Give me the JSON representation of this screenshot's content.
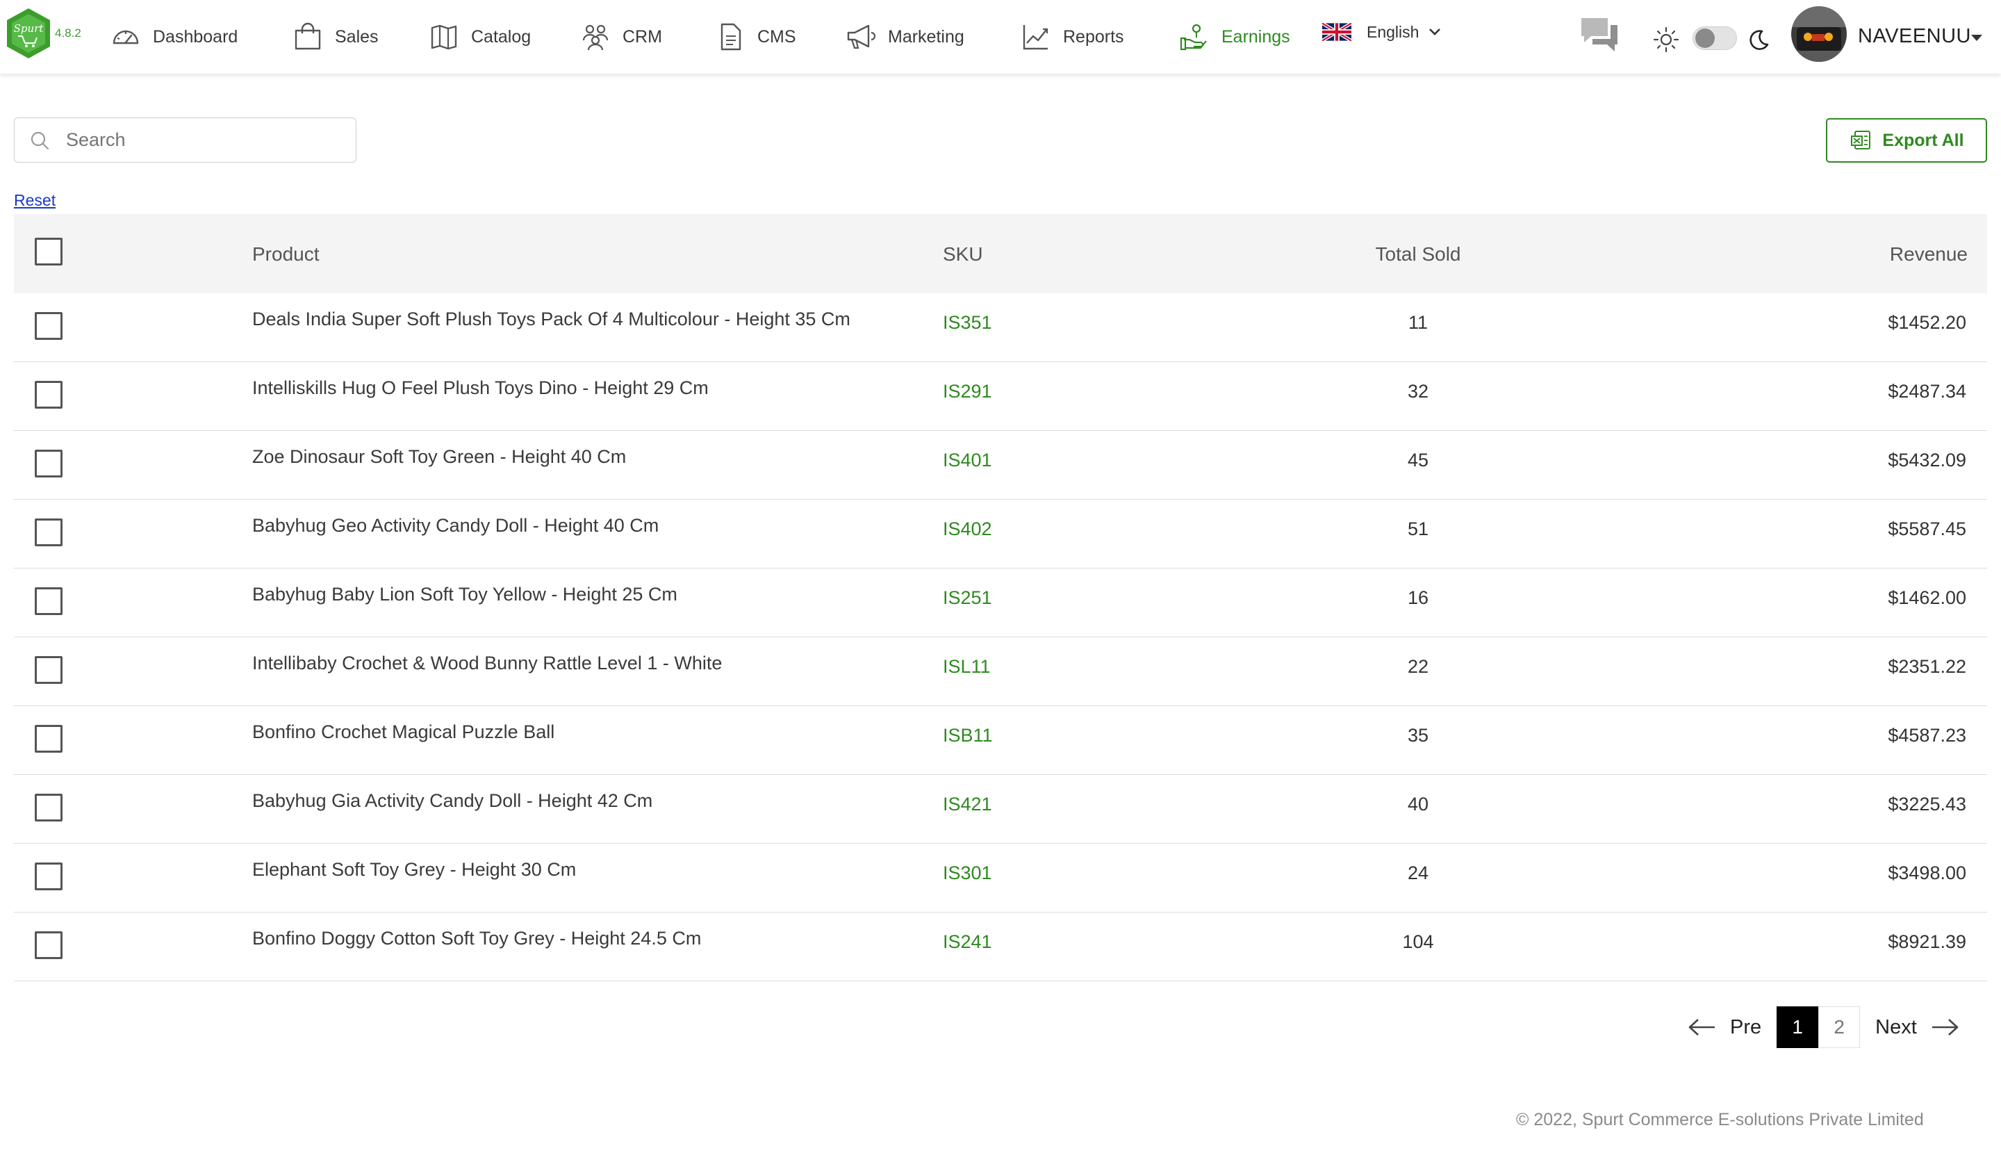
{
  "app": {
    "version": "4.8.2",
    "logo_text": "Spurt"
  },
  "nav": {
    "items": [
      {
        "label": "Dashboard",
        "icon": "dashboard-gauge-icon"
      },
      {
        "label": "Sales",
        "icon": "shopping-bag-icon"
      },
      {
        "label": "Catalog",
        "icon": "catalog-map-icon"
      },
      {
        "label": "CRM",
        "icon": "users-group-icon"
      },
      {
        "label": "CMS",
        "icon": "document-icon"
      },
      {
        "label": "Marketing",
        "icon": "megaphone-icon"
      },
      {
        "label": "Reports",
        "icon": "line-chart-icon"
      },
      {
        "label": "Earnings",
        "icon": "earnings-hand-coins-icon",
        "active": true
      }
    ],
    "language": "English",
    "username": "NAVEENUU",
    "theme_toggle": "light"
  },
  "toolbar": {
    "search_placeholder": "Search",
    "search_value": "",
    "export_label": "Export All",
    "reset_label": "Reset"
  },
  "table": {
    "columns": [
      "Product",
      "SKU",
      "Total Sold",
      "Revenue"
    ],
    "rows": [
      {
        "product": "Deals India Super Soft Plush Toys Pack Of 4 Multicolour - Height 35 Cm",
        "sku": "IS351",
        "sold": "11",
        "revenue": "$1452.20"
      },
      {
        "product": "Intelliskills Hug O Feel Plush Toys Dino - Height 29 Cm",
        "sku": "IS291",
        "sold": "32",
        "revenue": "$2487.34"
      },
      {
        "product": "Zoe Dinosaur Soft Toy Green - Height 40 Cm",
        "sku": "IS401",
        "sold": "45",
        "revenue": "$5432.09"
      },
      {
        "product": "Babyhug Geo Activity Candy Doll - Height 40 Cm",
        "sku": "IS402",
        "sold": "51",
        "revenue": "$5587.45"
      },
      {
        "product": "Babyhug Baby Lion Soft Toy Yellow - Height 25 Cm",
        "sku": "IS251",
        "sold": "16",
        "revenue": "$1462.00"
      },
      {
        "product": "Intellibaby Crochet & Wood Bunny Rattle Level 1 - White",
        "sku": "ISL11",
        "sold": "22",
        "revenue": "$2351.22"
      },
      {
        "product": "Bonfino Crochet Magical Puzzle Ball",
        "sku": "ISB11",
        "sold": "35",
        "revenue": "$4587.23"
      },
      {
        "product": "Babyhug Gia Activity Candy Doll - Height 42 Cm",
        "sku": "IS421",
        "sold": "40",
        "revenue": "$3225.43"
      },
      {
        "product": "Elephant Soft Toy Grey - Height 30 Cm",
        "sku": "IS301",
        "sold": "24",
        "revenue": "$3498.00"
      },
      {
        "product": "Bonfino Doggy Cotton Soft Toy Grey - Height 24.5 Cm",
        "sku": "IS241",
        "sold": "104",
        "revenue": "$8921.39"
      }
    ]
  },
  "pagination": {
    "prev_label": "Pre",
    "next_label": "Next",
    "pages": [
      "1",
      "2"
    ],
    "current_page": "1"
  },
  "footer": {
    "copyright": "© 2022, Spurt Commerce E-solutions Private Limited"
  },
  "colors": {
    "accent_green": "#2e8a1f",
    "link_blue": "#1a38c8",
    "header_row_bg": "#f4f4f4"
  }
}
